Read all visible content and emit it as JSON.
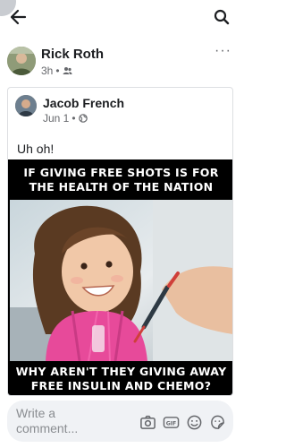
{
  "header": {
    "back_icon": "arrow-left-icon",
    "search_icon": "search-icon"
  },
  "post": {
    "author": "Rick Roth",
    "time": "3h",
    "audience_icon": "friends-icon",
    "more_icon": "more-horizontal-icon"
  },
  "shared": {
    "author": "Jacob French",
    "time": "Jun 1",
    "audience_icon": "globe-icon",
    "text": "Uh oh!"
  },
  "meme": {
    "top_line_1": "IF GIVING FREE SHOTS IS FOR",
    "top_line_2": "THE HEALTH OF THE NATION",
    "bottom_line_1": "WHY AREN'T THEY GIVING AWAY",
    "bottom_line_2": "FREE INSULIN AND CHEMO?"
  },
  "comment": {
    "placeholder": "Write a\ncomment...",
    "icons": [
      "camera-icon",
      "gif-icon",
      "emoji-icon",
      "sticker-icon"
    ]
  }
}
